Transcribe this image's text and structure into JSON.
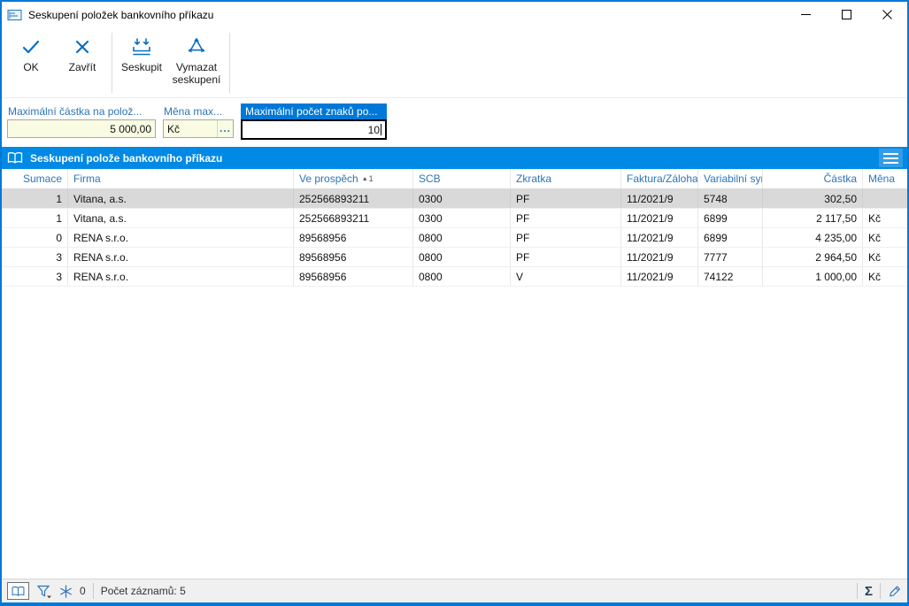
{
  "colors": {
    "accent": "#0078d7",
    "grid_header_bg": "#0089e5",
    "label_blue": "#2e75b6",
    "field_bg": "#f9fce3",
    "selected_row_bg": "#d9d9d9",
    "statusbar_bg": "#f0f0f0",
    "icon_blue": "#0a6fc2"
  },
  "window": {
    "title": "Seskupení položek bankovního příkazu"
  },
  "toolbar": {
    "ok_label": "OK",
    "close_label": "Zavřít",
    "group_label": "Seskupit",
    "clear_group_label": "Vymazat seskupení"
  },
  "params": {
    "max_amount": {
      "label": "Maximální částka na polož...",
      "value": "5 000,00"
    },
    "currency": {
      "label": "Měna max...",
      "value": "Kč",
      "picker_label": "..."
    },
    "max_chars": {
      "label": "Maximální počet znaků po...",
      "value": "10"
    }
  },
  "grid": {
    "section_title": "Seskupení polože bankovního příkazu",
    "columns": [
      "Sumace",
      "Firma",
      "Ve prospěch",
      "SCB",
      "Zkratka",
      "Faktura/Záloha",
      "Variabilní symb",
      "Částka",
      "Měna"
    ],
    "sort": {
      "column_index": 2,
      "direction": "asc",
      "priority": "1"
    },
    "selected_row_index": 0,
    "rows": [
      [
        "1",
        "Vitana, a.s.",
        "252566893211",
        "0300",
        "PF",
        "11/2021/9",
        "5748",
        "302,50",
        ""
      ],
      [
        "1",
        "Vitana, a.s.",
        "252566893211",
        "0300",
        "PF",
        "11/2021/9",
        "6899",
        "2 117,50",
        "Kč"
      ],
      [
        "0",
        "RENA s.r.o.",
        "89568956",
        "0800",
        "PF",
        "11/2021/9",
        "6899",
        "4 235,00",
        "Kč"
      ],
      [
        "3",
        "RENA s.r.o.",
        "89568956",
        "0800",
        "PF",
        "11/2021/9",
        "7777",
        "2 964,50",
        "Kč"
      ],
      [
        "3",
        "RENA s.r.o.",
        "89568956",
        "0800",
        "V",
        "11/2021/9",
        "74122",
        "1 000,00",
        "Kč"
      ]
    ]
  },
  "statusbar": {
    "frozen_count": "0",
    "record_count_label": "Počet záznamů: 5",
    "sum_symbol": "Σ"
  }
}
